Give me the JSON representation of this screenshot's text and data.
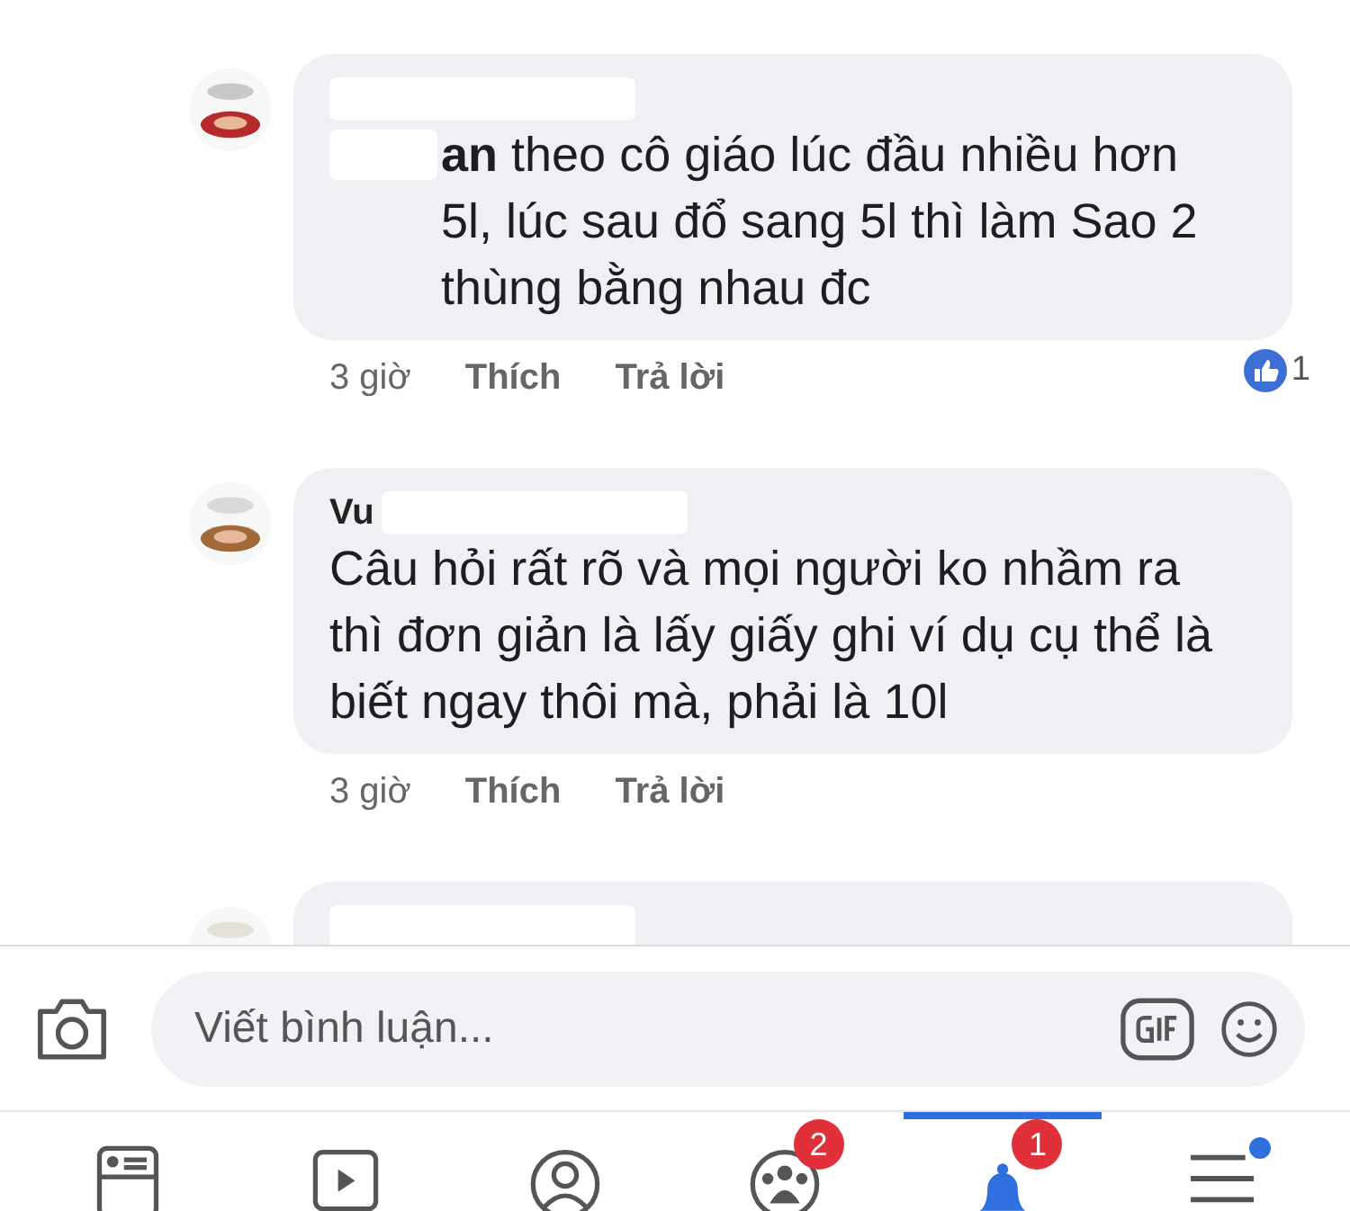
{
  "comments": [
    {
      "redacted_author": true,
      "text": "**an** theo cô giáo lúc đầu nhiều hơn 5l, lúc sau đổ sang 5l thì làm Sao 2 thùng bằng nhau đc",
      "mention_redacted": true,
      "time": "3 giờ",
      "like": "Thích",
      "reply": "Trả lời",
      "reactions": "1"
    },
    {
      "author": "Vu",
      "redacted_author": true,
      "text": "Câu hỏi rất rõ và mọi người ko nhầm ra thì đơn giản là lấy giấy ghi ví dụ cụ thể là biết ngay thôi mà, phải là 10l",
      "time": "3 giờ",
      "like": "Thích",
      "reply": "Trả lời"
    },
    {
      "redacted_author": true
    }
  ],
  "composer": {
    "placeholder": "Viết bình luận..."
  },
  "nav": [
    {
      "kind": "feed",
      "selected": false
    },
    {
      "kind": "video",
      "selected": false
    },
    {
      "kind": "profile",
      "selected": false
    },
    {
      "kind": "groups",
      "selected": false,
      "badge": "2"
    },
    {
      "kind": "bell",
      "selected": true,
      "badge": "1"
    },
    {
      "kind": "menu",
      "selected": false,
      "dot": true
    }
  ]
}
